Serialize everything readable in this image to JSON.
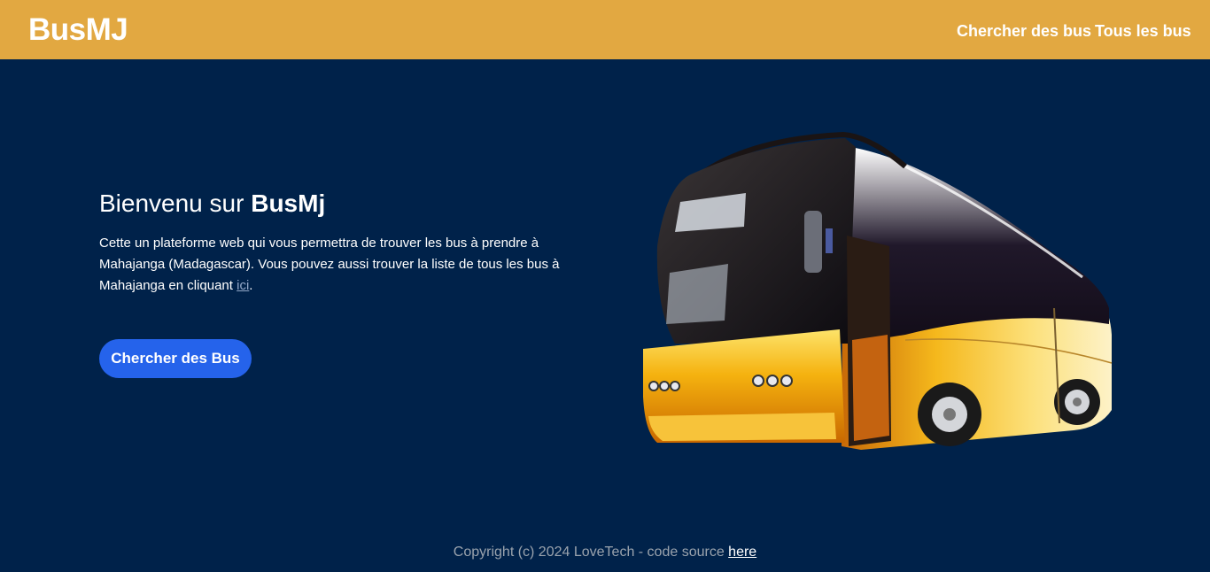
{
  "navbar": {
    "brand": "BusMJ",
    "links": [
      {
        "label": "Chercher des bus"
      },
      {
        "label": "Tous les bus"
      }
    ],
    "background": "#e2a841"
  },
  "hero": {
    "title_prefix": "Bienvenu sur ",
    "title_brand": "BusMj",
    "text_before_link": "Cette un plateforme web qui vous permettra de trouver les bus à prendre à Mahajanga (Madagascar). Vous pouvez aussi trouver la liste de tous les bus à Mahajanga en cliquant ",
    "link_label": "ici",
    "text_after_link": ".",
    "button_label": "Chercher des Bus",
    "button_color": "#2563eb",
    "image": "bus-illustration"
  },
  "footer": {
    "text": "Copyright (c) 2024 LoveTech - code source ",
    "link_label": "here"
  },
  "theme": {
    "page_background": "#00224a"
  }
}
